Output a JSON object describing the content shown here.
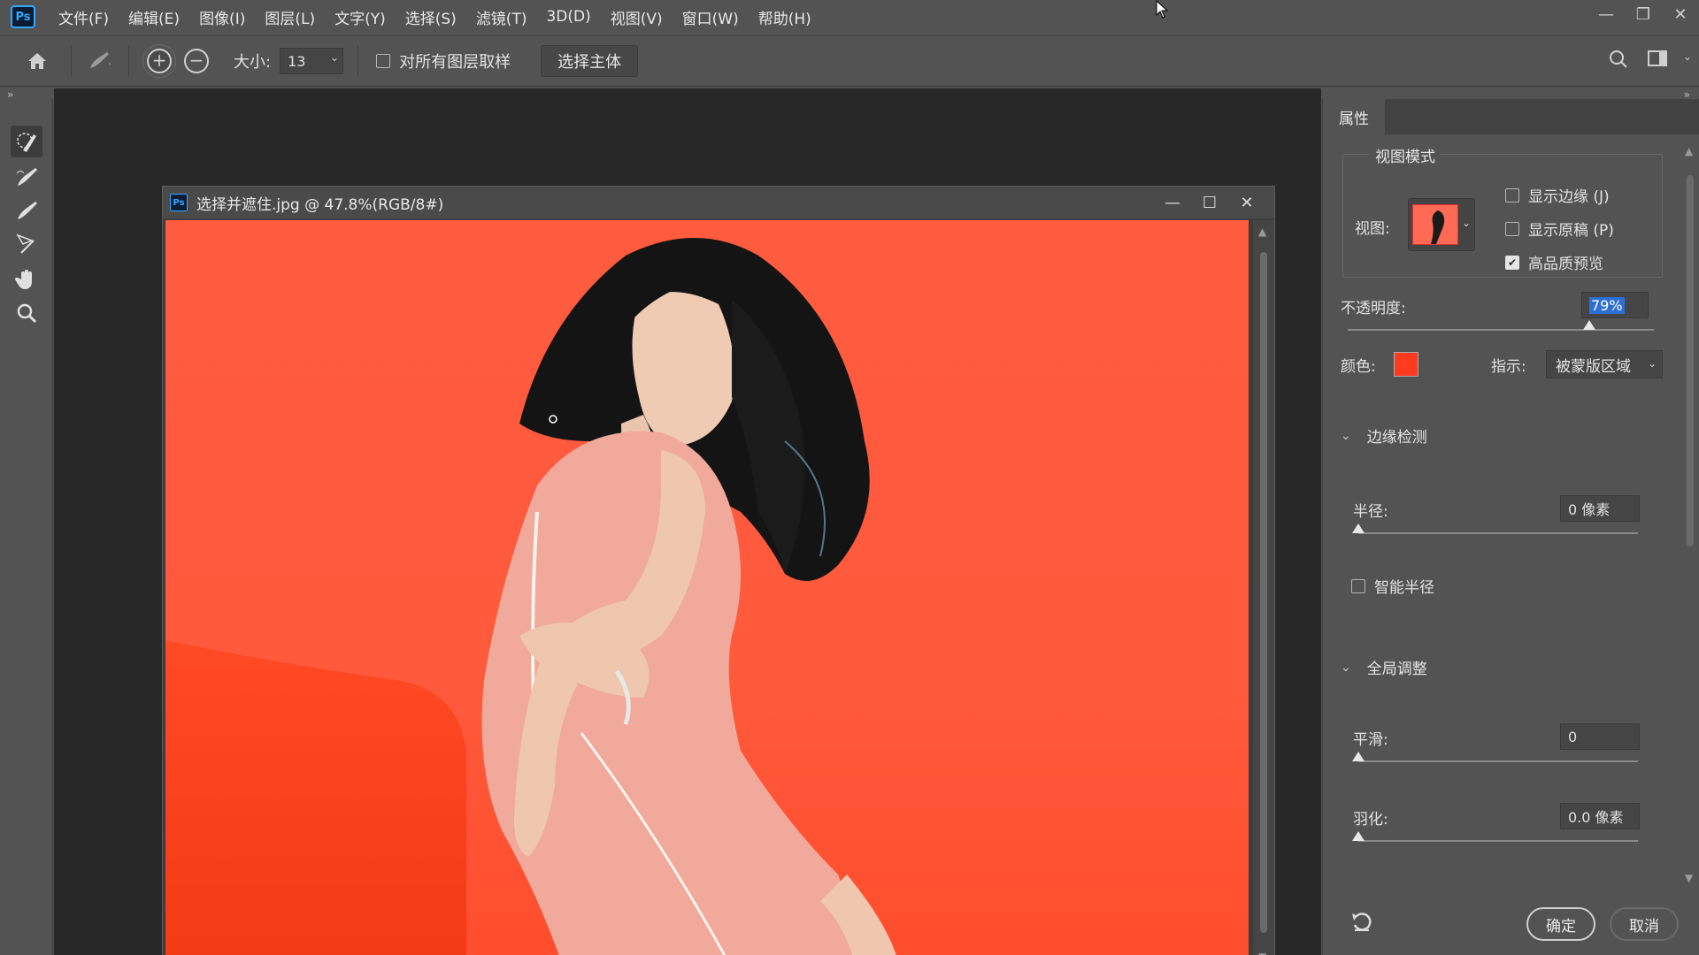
{
  "app": {
    "logo": "Ps"
  },
  "menu": [
    "文件(F)",
    "编辑(E)",
    "图像(I)",
    "图层(L)",
    "文字(Y)",
    "选择(S)",
    "滤镜(T)",
    "3D(D)",
    "视图(V)",
    "窗口(W)",
    "帮助(H)"
  ],
  "options": {
    "size_label": "大小:",
    "size_value": "13",
    "sample_all_label": "对所有图层取样",
    "sample_all_checked": false,
    "select_subject": "选择主体"
  },
  "document": {
    "title": "选择并遮住.jpg @ 47.8%(RGB/8#)",
    "canvas_color": "#ff5a3c"
  },
  "panel": {
    "tab": "属性",
    "view_mode_title": "视图模式",
    "view_label": "视图:",
    "show_edge": "显示边缘 (J)",
    "show_edge_checked": false,
    "show_original": "显示原稿 (P)",
    "show_original_checked": false,
    "hq_preview": "高品质预览",
    "hq_preview_checked": true,
    "opacity_label": "不透明度:",
    "opacity_value": "79%",
    "opacity_level": 0.79,
    "color_label": "颜色:",
    "color_value": "#ff3b1f",
    "indicate_label": "指示:",
    "indicate_value": "被蒙版区域",
    "edge_detection": "边缘检测",
    "radius_label": "半径:",
    "radius_value": "0 像素",
    "radius_level": 0,
    "smart_radius": "智能半径",
    "smart_radius_checked": false,
    "global_refine": "全局调整",
    "smooth_label": "平滑:",
    "smooth_value": "0",
    "smooth_level": 0,
    "feather_label": "羽化:",
    "feather_value": "0.0 像素",
    "feather_level": 0,
    "ok": "确定",
    "cancel": "取消"
  }
}
